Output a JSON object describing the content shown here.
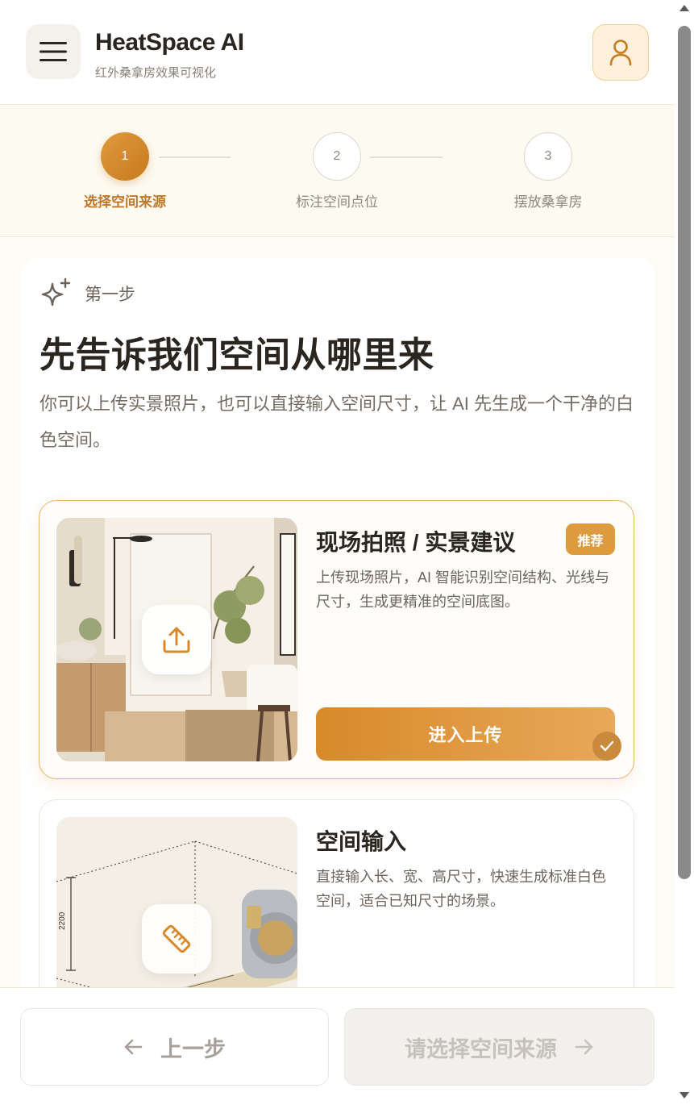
{
  "header": {
    "title": "HeatSpace AI",
    "subtitle": "红外桑拿房效果可视化",
    "menu_icon": "hamburger-menu-icon",
    "user_icon": "user-icon"
  },
  "stepper": {
    "current": 1,
    "steps": [
      {
        "number": "1",
        "label": "选择空间来源"
      },
      {
        "number": "2",
        "label": "标注空间点位"
      },
      {
        "number": "3",
        "label": "摆放桑拿房"
      }
    ]
  },
  "main": {
    "step_tag": "第一步",
    "title": "先告诉我们空间从哪里来",
    "description": "你可以上传实景照片，也可以直接输入空间尺寸，让 AI 先生成一个干净的白色空间。",
    "options": [
      {
        "title": "现场拍照 / 实景建议",
        "badge": "推荐",
        "description": "上传现场照片，AI 智能识别空间结构、光线与尺寸，生成更精准的空间底图。",
        "button": "进入上传",
        "icon": "upload-icon",
        "selected": true
      },
      {
        "title": "空间输入",
        "description": "直接输入长、宽、高尺寸，快速生成标准白色空间，适合已知尺寸的场景。",
        "icon": "ruler-icon",
        "dimension_label": "2200",
        "selected": false
      }
    ]
  },
  "footer": {
    "prev_label": "上一步",
    "next_label": "请选择空间来源"
  },
  "colors": {
    "accent": "#d88a2a",
    "accent_light": "#fdf1dc",
    "text_dark": "#2b2520",
    "text_muted": "#8f877e",
    "background": "#fdfbf6"
  }
}
